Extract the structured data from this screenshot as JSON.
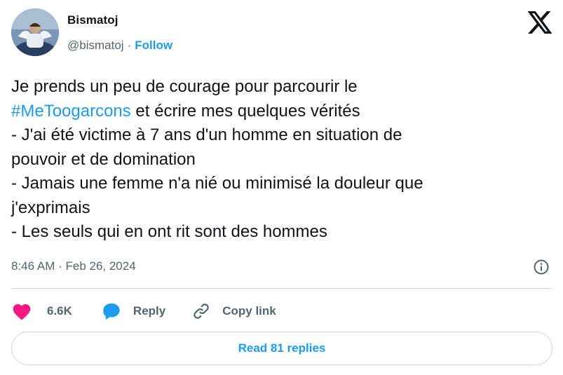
{
  "author": {
    "name": "Bismatoj",
    "handle": "@bismatoj",
    "separator": "·",
    "follow_label": "Follow",
    "avatar_icon": "profile-avatar"
  },
  "platform_icon": "x-logo-icon",
  "tweet": {
    "line1_prefix": "Je prends un peu de courage pour parcourir le",
    "hashtag": "#MeToogarcons",
    "line2_suffix": " et écrire mes quelques vérités",
    "rest": "- J'ai été victime à 7 ans d'un homme en situation de\npouvoir et de domination\n- Jamais une femme n'a nié ou minimisé la douleur que\nj'exprimais\n- Les seuls qui en ont rit sont des hommes"
  },
  "meta": {
    "timestamp": "8:46 AM · Feb 26, 2024",
    "info_icon": "info-icon"
  },
  "actions": {
    "like_count": "6.6K",
    "reply_label": "Reply",
    "copy_label": "Copy link"
  },
  "replies_button": "Read 81 replies",
  "colors": {
    "accent": "#1d9bf0",
    "like": "#f91880",
    "text": "#0f1419",
    "secondary": "#536471",
    "border": "#cfd9de"
  }
}
